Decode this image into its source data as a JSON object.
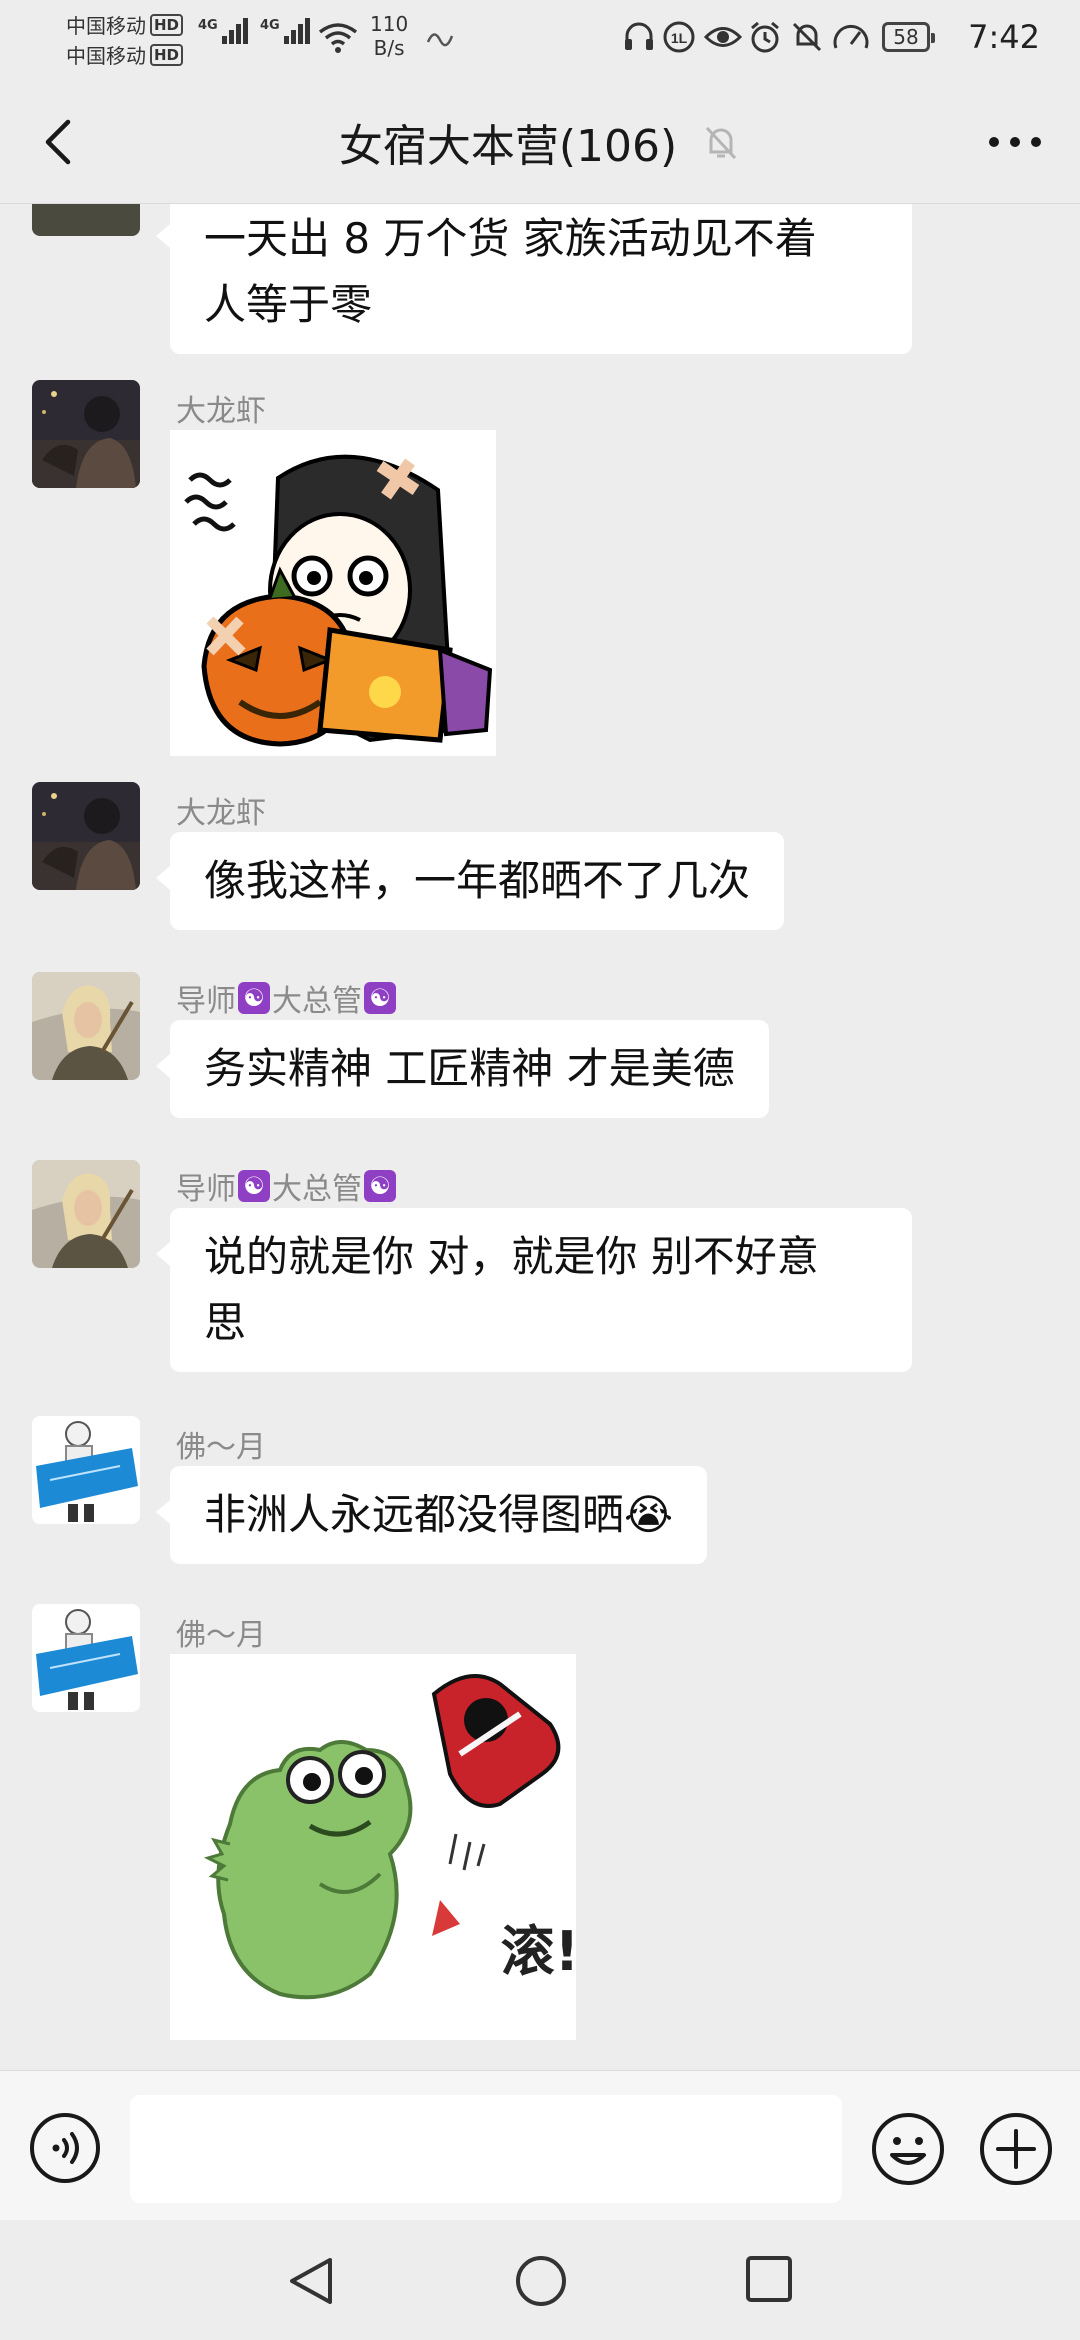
{
  "status_bar": {
    "carrier1": "中国移动",
    "carrier2": "中国移动",
    "hd": "HD",
    "net_tag": "4G",
    "net_speed_value": "110",
    "net_speed_unit": "B/s",
    "battery": "58",
    "time": "7:42",
    "icons": [
      "headset-icon",
      "volte-icon",
      "eye-icon",
      "alarm-icon",
      "mute-bell-icon",
      "speed-icon"
    ]
  },
  "header": {
    "title": "女宿大本营(106)",
    "back_icon": "chevron-left-icon",
    "mute_icon": "bell-off-icon",
    "more_icon": "more-dots-icon"
  },
  "messages": [
    {
      "type": "text",
      "sender": "",
      "text_lines": [
        "一天出 8 万个货   家族活动见不着",
        "人等于零"
      ]
    },
    {
      "type": "sticker",
      "sender": "大龙虾",
      "sticker": "pumpkin-girl-sticker"
    },
    {
      "type": "text",
      "sender": "大龙虾",
      "text": "像我这样，一年都晒不了几次"
    },
    {
      "type": "text",
      "sender_parts": [
        "导师",
        "大总管"
      ],
      "badge": "☯",
      "text": "务实精神 工匠精神 才是美德"
    },
    {
      "type": "text",
      "sender_parts": [
        "导师",
        "大总管"
      ],
      "badge": "☯",
      "text_lines": [
        "说的就是你  对，就是你  别不好意",
        "思"
      ]
    },
    {
      "type": "text",
      "sender": "佛～月",
      "text": "非洲人永远都没得图晒",
      "emoji": "😭"
    },
    {
      "type": "sticker",
      "sender": "佛～月",
      "sticker": "frog-sticker",
      "caption": "滚!"
    }
  ],
  "input_bar": {
    "placeholder": "",
    "voice_icon": "voice-icon",
    "emoji_icon": "emoji-icon",
    "plus_icon": "plus-icon"
  },
  "nav_bar": {
    "icons": [
      "nav-back-icon",
      "nav-home-icon",
      "nav-recent-icon"
    ]
  },
  "colors": {
    "background": "#ededed",
    "bubble": "#ffffff",
    "sender_text": "#8a8a8a",
    "badge": "#8e3fc4"
  }
}
